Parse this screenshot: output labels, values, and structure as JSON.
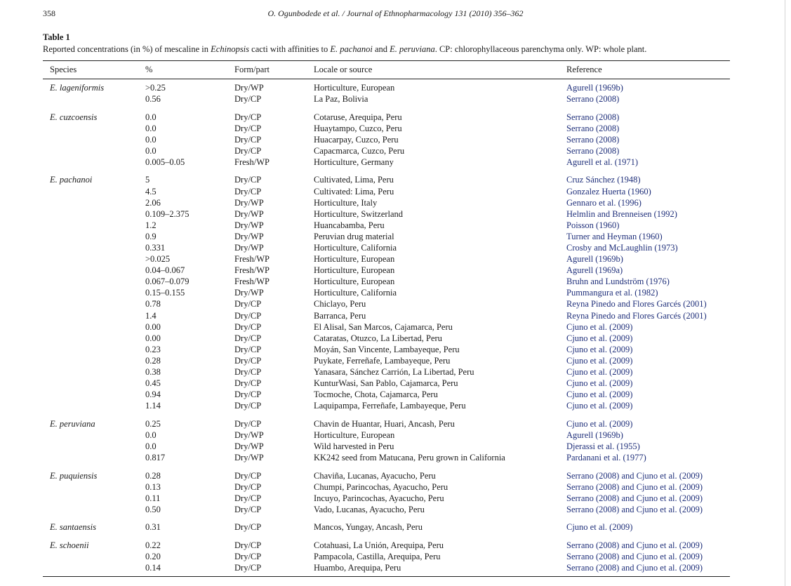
{
  "page_number": "358",
  "running_head": "O. Ogunbodede et al. / Journal of Ethnopharmacology 131 (2010) 356–362",
  "table_label": "Table 1",
  "caption": {
    "before_genus": "Reported concentrations (in %) of mescaline in ",
    "genus": "Echinopsis",
    "middle1": " cacti with affinities to ",
    "species1": "E. pachanoi",
    "middle2": " and ",
    "species2": "E. peruviana",
    "after": ". CP: chlorophyllaceous parenchyma only. WP: whole plant."
  },
  "columns": [
    "Species",
    "%",
    "Form/part",
    "Locale or source",
    "Reference"
  ],
  "groups": [
    {
      "species": "E. lageniformis",
      "rows": [
        [
          ">0.25",
          "Dry/WP",
          "Horticulture, European",
          "Agurell (1969b)"
        ],
        [
          "0.56",
          "Dry/CP",
          "La Paz, Bolivia",
          "Serrano (2008)"
        ]
      ]
    },
    {
      "species": "E. cuzcoensis",
      "rows": [
        [
          "0.0",
          "Dry/CP",
          "Cotaruse, Arequipa, Peru",
          "Serrano (2008)"
        ],
        [
          "0.0",
          "Dry/CP",
          "Huaytampo, Cuzco, Peru",
          "Serrano (2008)"
        ],
        [
          "0.0",
          "Dry/CP",
          "Huacarpay, Cuzco, Peru",
          "Serrano (2008)"
        ],
        [
          "0.0",
          "Dry/CP",
          "Capacmarca, Cuzco, Peru",
          "Serrano (2008)"
        ],
        [
          "0.005–0.05",
          "Fresh/WP",
          "Horticulture, Germany",
          "Agurell et al. (1971)"
        ]
      ]
    },
    {
      "species": "E. pachanoi",
      "rows": [
        [
          "5",
          "Dry/CP",
          "Cultivated, Lima, Peru",
          "Cruz Sánchez (1948)"
        ],
        [
          "4.5",
          "Dry/CP",
          "Cultivated: Lima, Peru",
          "Gonzalez Huerta (1960)"
        ],
        [
          "2.06",
          "Dry/WP",
          "Horticulture, Italy",
          "Gennaro et al. (1996)"
        ],
        [
          "0.109–2.375",
          "Dry/WP",
          "Horticulture, Switzerland",
          "Helmlin and Brenneisen (1992)"
        ],
        [
          "1.2",
          "Dry/WP",
          "Huancabamba, Peru",
          "Poisson (1960)"
        ],
        [
          "0.9",
          "Dry/WP",
          "Peruvian drug material",
          "Turner and Heyman (1960)"
        ],
        [
          "0.331",
          "Dry/WP",
          "Horticulture, California",
          "Crosby and McLaughlin (1973)"
        ],
        [
          ">0.025",
          "Fresh/WP",
          "Horticulture, European",
          "Agurell (1969b)"
        ],
        [
          "0.04–0.067",
          "Fresh/WP",
          "Horticulture, European",
          "Agurell (1969a)"
        ],
        [
          "0.067–0.079",
          "Fresh/WP",
          "Horticulture, European",
          "Bruhn and Lundström (1976)"
        ],
        [
          "0.15–0.155",
          "Dry/WP",
          "Horticulture, California",
          "Pummangura et al. (1982)"
        ],
        [
          "0.78",
          "Dry/CP",
          "Chiclayo, Peru",
          "Reyna Pinedo and Flores Garcés (2001)"
        ],
        [
          "1.4",
          "Dry/CP",
          "Barranca, Peru",
          "Reyna Pinedo and Flores Garcés (2001)"
        ],
        [
          "0.00",
          "Dry/CP",
          "El Alisal, San Marcos, Cajamarca, Peru",
          "Cjuno et al. (2009)"
        ],
        [
          "0.00",
          "Dry/CP",
          "Cataratas, Otuzco, La Libertad, Peru",
          "Cjuno et al. (2009)"
        ],
        [
          "0.23",
          "Dry/CP",
          "Moyán, San Vincente, Lambayeque, Peru",
          "Cjuno et al. (2009)"
        ],
        [
          "0.28",
          "Dry/CP",
          "Puykate, Ferreñafe, Lambayeque, Peru",
          "Cjuno et al. (2009)"
        ],
        [
          "0.38",
          "Dry/CP",
          "Yanasara, Sánchez Carrión, La Libertad, Peru",
          "Cjuno et al. (2009)"
        ],
        [
          "0.45",
          "Dry/CP",
          "KunturWasi, San Pablo, Cajamarca, Peru",
          "Cjuno et al. (2009)"
        ],
        [
          "0.94",
          "Dry/CP",
          "Tocmoche, Chota, Cajamarca, Peru",
          "Cjuno et al. (2009)"
        ],
        [
          "1.14",
          "Dry/CP",
          "Laquipampa, Ferreñafe, Lambayeque, Peru",
          "Cjuno et al. (2009)"
        ]
      ]
    },
    {
      "species": "E. peruviana",
      "rows": [
        [
          "0.25",
          "Dry/CP",
          "Chavin de Huantar, Huari, Ancash, Peru",
          "Cjuno et al. (2009)"
        ],
        [
          "0.0",
          "Dry/WP",
          "Horticulture, European",
          "Agurell (1969b)"
        ],
        [
          "0.0",
          "Dry/WP",
          "Wild harvested in Peru",
          "Djerassi et al. (1955)"
        ],
        [
          "0.817",
          "Dry/WP",
          "KK242 seed from Matucana, Peru grown in California",
          "Pardanani et al. (1977)"
        ]
      ]
    },
    {
      "species": "E. puquiensis",
      "rows": [
        [
          "0.28",
          "Dry/CP",
          "Chaviña, Lucanas, Ayacucho, Peru",
          "Serrano (2008) and Cjuno et al. (2009)"
        ],
        [
          "0.13",
          "Dry/CP",
          "Chumpi, Parincochas, Ayacucho, Peru",
          "Serrano (2008) and Cjuno et al. (2009)"
        ],
        [
          "0.11",
          "Dry/CP",
          "Incuyo, Parincochas, Ayacucho, Peru",
          "Serrano (2008) and Cjuno et al. (2009)"
        ],
        [
          "0.50",
          "Dry/CP",
          "Vado, Lucanas, Ayacucho, Peru",
          "Serrano (2008) and Cjuno et al. (2009)"
        ]
      ]
    },
    {
      "species": "E. santaensis",
      "rows": [
        [
          "0.31",
          "Dry/CP",
          "Mancos, Yungay, Ancash, Peru",
          "Cjuno et al. (2009)"
        ]
      ]
    },
    {
      "species": "E. schoenii",
      "rows": [
        [
          "0.22",
          "Dry/CP",
          "Cotahuasi, La Unión, Arequipa, Peru",
          "Serrano (2008) and Cjuno et al. (2009)"
        ],
        [
          "0.20",
          "Dry/CP",
          "Pampacola, Castilla, Arequipa, Peru",
          "Serrano (2008) and Cjuno et al. (2009)"
        ],
        [
          "0.14",
          "Dry/CP",
          "Huambo, Arequipa, Peru",
          "Serrano (2008) and Cjuno et al. (2009)"
        ]
      ]
    }
  ]
}
